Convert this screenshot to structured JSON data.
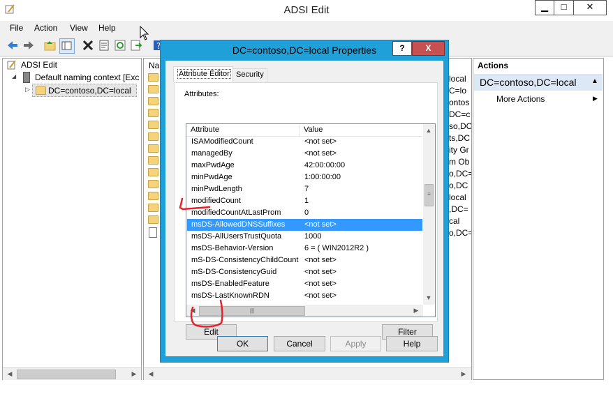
{
  "window": {
    "title": "ADSI Edit"
  },
  "menu": [
    "File",
    "Action",
    "View",
    "Help"
  ],
  "tree": {
    "root": "ADSI Edit",
    "context": "Default naming context [Exc",
    "node": "DC=contoso,DC=local"
  },
  "middle": {
    "header": "Na",
    "peek": [
      "local",
      "C=lo",
      "ontos",
      "DC=c",
      "so,DC",
      "ts,DC",
      "ity Gr",
      "m Ob",
      "o,DC=",
      "o,DC",
      "local",
      ",DC=",
      "cal",
      "o,DC="
    ]
  },
  "actions": {
    "header": "Actions",
    "selected": "DC=contoso,DC=local",
    "more": "More Actions"
  },
  "dialog": {
    "title": "DC=contoso,DC=local Properties",
    "help_btn": "?",
    "close_btn": "X",
    "tabs": [
      "Attribute Editor",
      "Security"
    ],
    "attributes_label": "Attributes:",
    "columns": [
      "Attribute",
      "Value"
    ],
    "rows": [
      {
        "attr": "ISAModifiedCount",
        "value": "<not set>"
      },
      {
        "attr": "managedBy",
        "value": "<not set>"
      },
      {
        "attr": "maxPwdAge",
        "value": "42:00:00:00"
      },
      {
        "attr": "minPwdAge",
        "value": "1:00:00:00"
      },
      {
        "attr": "minPwdLength",
        "value": "7"
      },
      {
        "attr": "modifiedCount",
        "value": "1"
      },
      {
        "attr": "modifiedCountAtLastProm",
        "value": "0"
      },
      {
        "attr": "msDS-AllowedDNSSuffixes",
        "value": "<not set>"
      },
      {
        "attr": "msDS-AllUsersTrustQuota",
        "value": "1000"
      },
      {
        "attr": "msDS-Behavior-Version",
        "value": "6 = ( WIN2012R2 )"
      },
      {
        "attr": "mS-DS-ConsistencyChildCount",
        "value": "<not set>"
      },
      {
        "attr": "mS-DS-ConsistencyGuid",
        "value": "<not set>"
      },
      {
        "attr": "msDS-EnabledFeature",
        "value": "<not set>"
      },
      {
        "attr": "msDS-LastKnownRDN",
        "value": "<not set>"
      }
    ],
    "selected_row": 7,
    "edit_btn": "Edit",
    "filter_btn": "Filter",
    "ok_btn": "OK",
    "cancel_btn": "Cancel",
    "apply_btn": "Apply",
    "help_footer_btn": "Help"
  },
  "colors": {
    "dialog_frame": "#1fa0d9",
    "selection": "#3399ff",
    "annotation": "#e8202a"
  }
}
